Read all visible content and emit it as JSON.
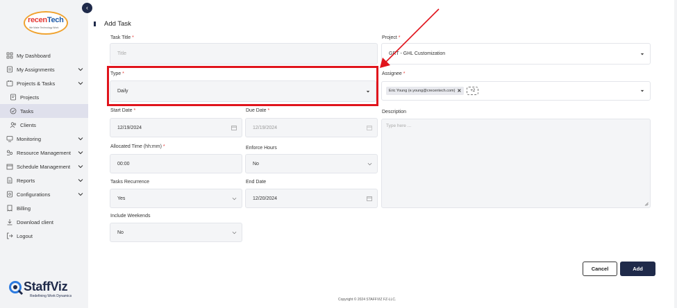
{
  "logo": {
    "part1": "recen",
    "part2": "Tech",
    "tagline": "We Make Technology Work"
  },
  "sidebar": {
    "collapse_glyph": "‹",
    "items": [
      {
        "label": "My Dashboard",
        "icon": "dashboard-icon"
      },
      {
        "label": "My Assignments",
        "icon": "assignments-icon"
      },
      {
        "label": "Projects & Tasks",
        "icon": "projects-tasks-icon"
      },
      {
        "label": "Projects",
        "icon": "projects-icon"
      },
      {
        "label": "Tasks",
        "icon": "tasks-icon"
      },
      {
        "label": "Clients",
        "icon": "clients-icon"
      },
      {
        "label": "Monitoring",
        "icon": "monitoring-icon"
      },
      {
        "label": "Resource Management",
        "icon": "resource-icon"
      },
      {
        "label": "Schedule Management",
        "icon": "schedule-icon"
      },
      {
        "label": "Reports",
        "icon": "reports-icon"
      },
      {
        "label": "Configurations",
        "icon": "configurations-icon"
      },
      {
        "label": "Billing",
        "icon": "billing-icon"
      },
      {
        "label": "Download client",
        "icon": "download-icon"
      },
      {
        "label": "Logout",
        "icon": "logout-icon"
      }
    ]
  },
  "brand": {
    "name": "StaffViz",
    "tagline": "Redefining Work Dynamics"
  },
  "page": {
    "title": "Add Task"
  },
  "form": {
    "task_title": {
      "label": "Task Title",
      "placeholder": "Title"
    },
    "project": {
      "label": "Project",
      "value": "GRT - GHL Customization"
    },
    "type": {
      "label": "Type",
      "value": "Daily"
    },
    "assignee": {
      "label": "Assignee",
      "chip": "Eric Young (e.young@crecentech.com)",
      "chip_remove": "✕",
      "more": "+2"
    },
    "start_date": {
      "label": "Start Date",
      "value": "12/19/2024"
    },
    "due_date": {
      "label": "Due Date",
      "value": "12/19/2024"
    },
    "description": {
      "label": "Description",
      "placeholder": "Type here ..."
    },
    "allocated_time": {
      "label": "Allocated Time (hh:mm)",
      "value": "00:00"
    },
    "enforce_hours": {
      "label": "Enforce Hours",
      "value": "No"
    },
    "tasks_recurrence": {
      "label": "Tasks Recurrence",
      "value": "Yes"
    },
    "end_date": {
      "label": "End Date",
      "value": "12/20/2024"
    },
    "include_weekends": {
      "label": "Include Weekends",
      "value": "No"
    },
    "required_mark": "*"
  },
  "actions": {
    "cancel": "Cancel",
    "add": "Add"
  },
  "footer": {
    "copyright": "Copyright © 2024 STAFFVIZ FZ-LLC."
  },
  "colors": {
    "accent": "#1f2a4a",
    "highlight": "#e0141c",
    "required": "#e53935"
  }
}
